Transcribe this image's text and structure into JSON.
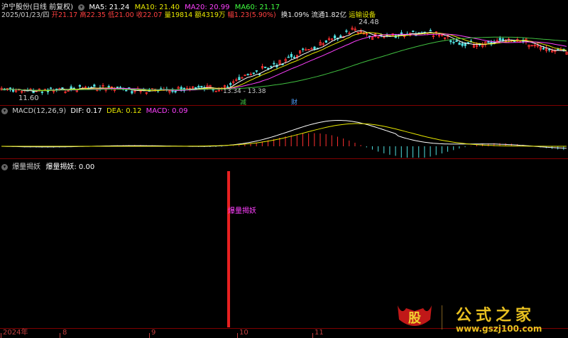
{
  "title_line": {
    "stock": "沪宁股份(日线 前复权)",
    "ma": [
      {
        "label": "MA5: 21.24",
        "color": "#ffffff"
      },
      {
        "label": "MA10: 21.40",
        "color": "#e8e800"
      },
      {
        "label": "MA20: 20.99",
        "color": "#ff40ff"
      },
      {
        "label": "MA60: 21.17",
        "color": "#40ff40"
      }
    ]
  },
  "quote_line": {
    "date": "2025/01/23/四",
    "open": "开21.17",
    "high": "高22.35",
    "low": "低21.00",
    "close": "收22.07",
    "volume": "量19814",
    "amount": "额4319万",
    "change": "幅1.23(5.90%)",
    "turnover": "换1.09%",
    "float": "流通1.82亿",
    "sector": "运输设备"
  },
  "price_annotations": {
    "high_label": "24.48",
    "low_label": "11.60",
    "range_label": "13.34 - 13.38",
    "tag_reduce": "减",
    "tag_finance": "财"
  },
  "macd_header": {
    "name": "MACD(12,26,9)",
    "dif": "DIF: 0.17",
    "dea": "DEA: 0.12",
    "macd": "MACD: 0.09"
  },
  "indicator_header": {
    "name": "爆量揭妖",
    "value_label": "爆量揭妖: 0.00",
    "signal_text": "爆量揭妖"
  },
  "time_axis": [
    {
      "label": "2024年"
    },
    {
      "label": "8"
    },
    {
      "label": "9"
    },
    {
      "label": "10"
    },
    {
      "label": "11"
    }
  ],
  "watermark": {
    "badge": "股",
    "brand": "公式之家",
    "url": "www.gszj100.com"
  },
  "colors": {
    "up": "#ff3030",
    "down": "#50e0e0",
    "ma5": "#ffffff",
    "ma10": "#e8e800",
    "ma20": "#ff40ff",
    "ma60": "#40c040",
    "axis": "#c04040"
  }
}
